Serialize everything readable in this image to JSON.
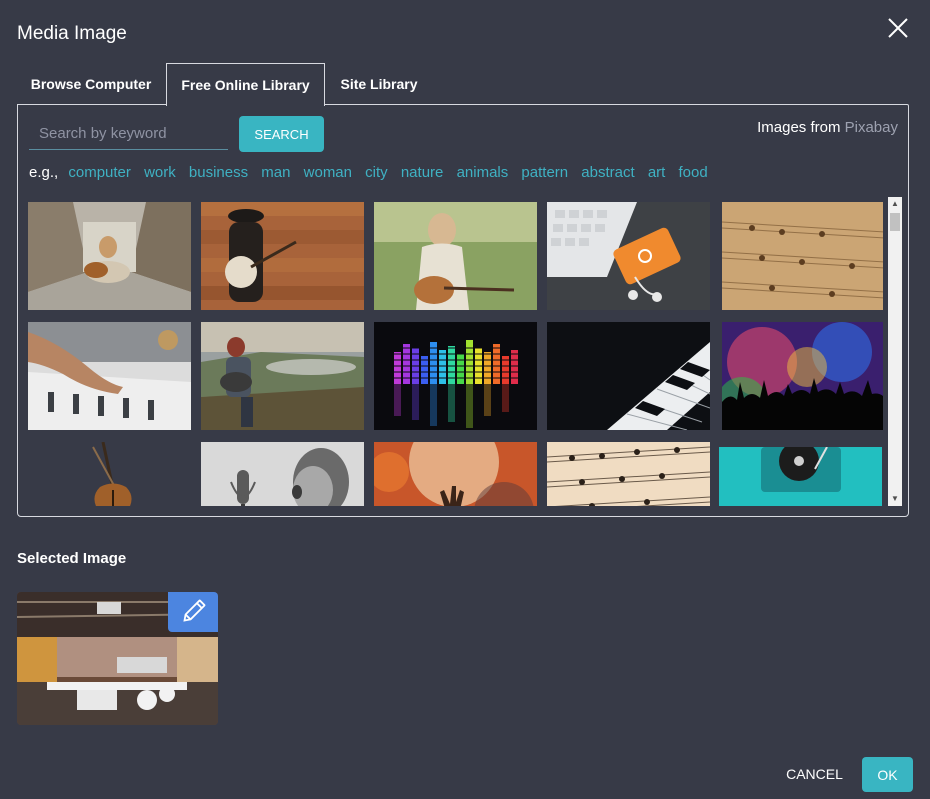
{
  "dialog": {
    "title": "Media Image",
    "close_icon": "close-icon"
  },
  "tabs": [
    {
      "label": "Browse Computer",
      "active": false
    },
    {
      "label": "Free Online Library",
      "active": true
    },
    {
      "label": "Site Library",
      "active": false
    }
  ],
  "search": {
    "value": "",
    "placeholder": "Search by keyword",
    "button_label": "SEARCH"
  },
  "source": {
    "prefix": "Images from",
    "name": "Pixabay"
  },
  "examples": {
    "label": "e.g.,",
    "keywords": [
      "computer",
      "work",
      "business",
      "man",
      "woman",
      "city",
      "nature",
      "animals",
      "pattern",
      "abstract",
      "art",
      "food"
    ]
  },
  "images": [
    {
      "name": "woman-with-guitar-on-bridge-image"
    },
    {
      "name": "man-with-banjo-wood-wall-image"
    },
    {
      "name": "woman-with-guitar-in-field-image"
    },
    {
      "name": "keyboard-phone-earphones-image"
    },
    {
      "name": "sheet-music-parchment-image"
    },
    {
      "name": "mixing-console-hand-image"
    },
    {
      "name": "man-with-guitar-on-rock-image"
    },
    {
      "name": "equalizer-bars-image"
    },
    {
      "name": "piano-keys-image"
    },
    {
      "name": "concert-crowd-silhouette-image"
    },
    {
      "name": "violin-image"
    },
    {
      "name": "boy-singing-microphone-image"
    },
    {
      "name": "concert-hands-lights-image"
    },
    {
      "name": "sheet-music-piano-image"
    },
    {
      "name": "turntable-teal-image"
    }
  ],
  "selected": {
    "label": "Selected Image",
    "image_name": "open-office-interior-image",
    "edit_icon": "pencil-icon"
  },
  "footer": {
    "cancel_label": "CANCEL",
    "ok_label": "OK"
  },
  "colors": {
    "background": "#373a47",
    "accent": "#39b5c2",
    "keyword": "#3fb1c3",
    "edit_button": "#4c85e0"
  }
}
